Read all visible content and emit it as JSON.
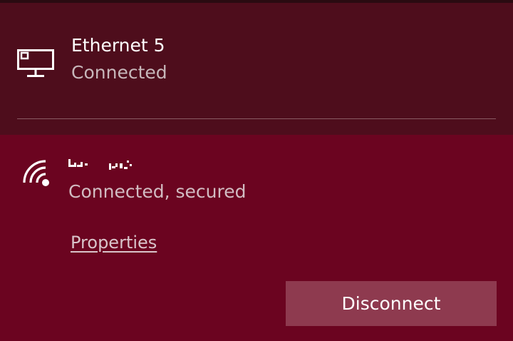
{
  "colors": {
    "ethernet_panel_bg": "#4e0d1c",
    "wifi_panel_bg": "#6b0420",
    "button_bg": "#8e3a4f",
    "secondary_text": "#c7b7ba"
  },
  "ethernet": {
    "icon": "ethernet-icon",
    "name": "Ethernet 5",
    "status": "Connected"
  },
  "wifi": {
    "icon": "wifi-icon",
    "status": "Connected, secured",
    "properties_label": "Properties",
    "disconnect_label": "Disconnect"
  }
}
